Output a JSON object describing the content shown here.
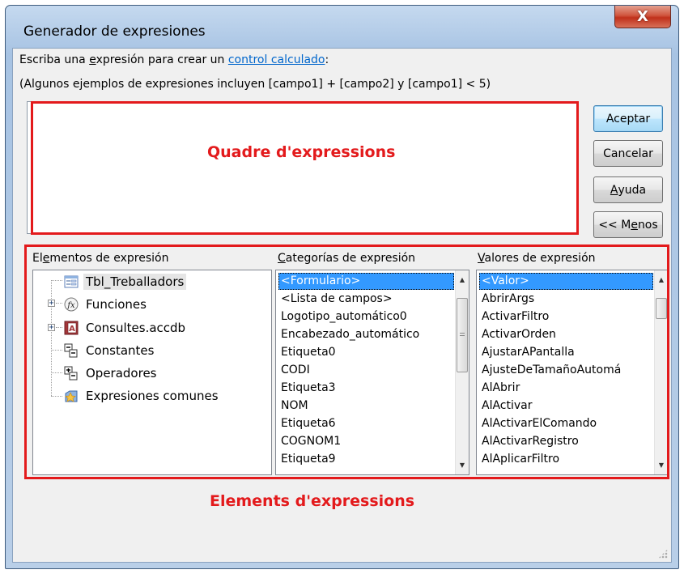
{
  "window": {
    "title": "Generador de expresiones",
    "close_symbol": "X"
  },
  "instructions": {
    "line1_prefix": "Escriba una ",
    "line1_underlined": "e",
    "line1_mid": "xpresión para crear un ",
    "line1_link": "control calculado",
    "line1_suffix": ":",
    "line2": "(Algunos ejemplos de expresiones incluyen [campo1] + [campo2] y [campo1] < 5)"
  },
  "expression_input": {
    "value": ""
  },
  "buttons": {
    "ok": "Aceptar",
    "cancel": "Cancelar",
    "help_underlined": "A",
    "help_rest": "yuda",
    "less_prefix": "<< M",
    "less_underlined": "e",
    "less_rest": "nos"
  },
  "panels": {
    "elements_label_a": "El",
    "elements_label_u": "e",
    "elements_label_b": "mentos de expresión",
    "categories_label_u": "C",
    "categories_label_b": "ategorías de expresión",
    "values_label_u": "V",
    "values_label_b": "alores de expresión"
  },
  "tree": {
    "items": [
      {
        "label": "Tbl_Treballadors",
        "icon": "form-icon",
        "selected": true
      },
      {
        "label": "Funciones",
        "icon": "function-icon",
        "expander": "+"
      },
      {
        "label": "Consultes.accdb",
        "icon": "database-icon",
        "expander": "+"
      },
      {
        "label": "Constantes",
        "icon": "constants-icon"
      },
      {
        "label": "Operadores",
        "icon": "operators-icon"
      },
      {
        "label": "Expresiones comunes",
        "icon": "common-expressions-icon"
      }
    ]
  },
  "categories": {
    "items": [
      "<Formulario>",
      "<Lista de campos>",
      "Logotipo_automático0",
      "Encabezado_automático",
      "Etiqueta0",
      "CODI",
      "Etiqueta3",
      "NOM",
      "Etiqueta6",
      "COGNOM1",
      "Etiqueta9"
    ],
    "selected_index": 0
  },
  "values": {
    "items": [
      "<Valor>",
      "AbrirArgs",
      "ActivarFiltro",
      "ActivarOrden",
      "AjustarAPantalla",
      "AjusteDeTamañoAutomá",
      "AlAbrir",
      "AlActivar",
      "AlActivarElComando",
      "AlActivarRegistro",
      "AlAplicarFiltro"
    ],
    "selected_index": 0
  },
  "annotations": {
    "expression_box": "Quadre d'expressions",
    "elements": "Elements d'expressions",
    "color": "#e31a1c"
  },
  "colors": {
    "selection": "#3399ff",
    "link": "#0066cc",
    "title_gradient_top": "#c5d9ef"
  }
}
